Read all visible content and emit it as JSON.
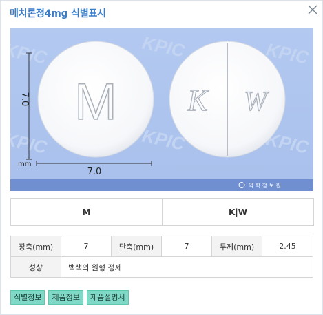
{
  "dialog": {
    "title": "메치론정4mg 식별표시",
    "close_icon": "close-x-icon"
  },
  "photo": {
    "watermark": "KPIC",
    "left_pill_imprint": "M",
    "right_pill_imprint_left": "K",
    "right_pill_imprint_right": "W",
    "dim_vertical": "7.0",
    "dim_horizontal": "7.0",
    "unit": "mm",
    "logo_text": "약 학 정 보 원",
    "colors": {
      "background": "#adc5ef",
      "pill": "#ffffff",
      "band": "#6f8fd0"
    }
  },
  "identification": {
    "front": "M",
    "back": "K|W"
  },
  "specs": {
    "row1": [
      {
        "label": "장축(mm)",
        "value": "7"
      },
      {
        "label": "단축(mm)",
        "value": "7"
      },
      {
        "label": "두께(mm)",
        "value": "2.45"
      }
    ],
    "row2": {
      "label": "성상",
      "value": "백색의 원형 정제"
    }
  },
  "buttons": {
    "id_info": "식별정보",
    "product_info": "제품정보",
    "product_leaflet": "제품설명서"
  },
  "button_color": "#7fd9c6"
}
